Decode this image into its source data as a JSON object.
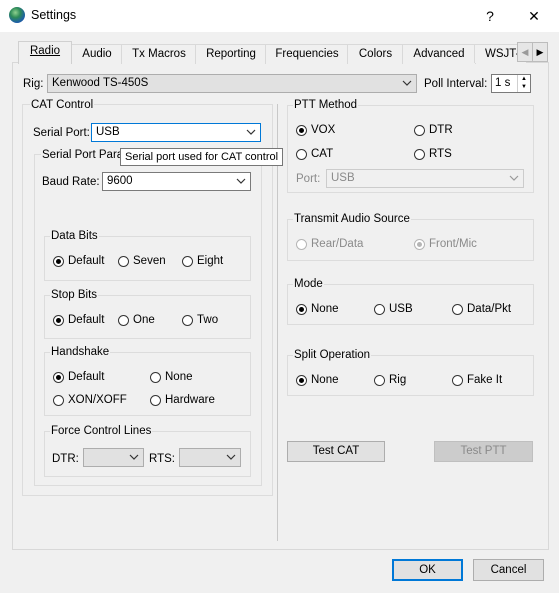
{
  "window": {
    "title": "Settings",
    "help_label": "?",
    "close_label": "✕"
  },
  "tabs": [
    "Radio",
    "Audio",
    "Tx Macros",
    "Reporting",
    "Frequencies",
    "Colors",
    "Advanced",
    "WSJT-Z"
  ],
  "active_tab": "Radio",
  "rig": {
    "label": "Rig:",
    "value": "Kenwood TS-450S",
    "poll_label": "Poll Interval:",
    "poll_value": "1 s"
  },
  "cat_control": {
    "title": "CAT Control",
    "serial_port_label": "Serial Port:",
    "serial_port_value": "USB",
    "serial_params_title": "Serial Port Param",
    "tooltip": "Serial port used for CAT control",
    "baud_rate_label": "Baud Rate:",
    "baud_rate_value": "9600",
    "data_bits": {
      "title": "Data Bits",
      "options": [
        "Default",
        "Seven",
        "Eight"
      ],
      "selected": "Default"
    },
    "stop_bits": {
      "title": "Stop Bits",
      "options": [
        "Default",
        "One",
        "Two"
      ],
      "selected": "Default"
    },
    "handshake": {
      "title": "Handshake",
      "options": [
        "Default",
        "None",
        "XON/XOFF",
        "Hardware"
      ],
      "selected": "Default"
    },
    "force_lines": {
      "title": "Force Control Lines",
      "dtr_label": "DTR:",
      "rts_label": "RTS:"
    }
  },
  "ptt": {
    "title": "PTT Method",
    "options": [
      "VOX",
      "DTR",
      "CAT",
      "RTS"
    ],
    "selected": "VOX",
    "port_label": "Port:",
    "port_value": "USB"
  },
  "tx_audio": {
    "title": "Transmit Audio Source",
    "options": [
      "Rear/Data",
      "Front/Mic"
    ],
    "selected": "Front/Mic"
  },
  "mode": {
    "title": "Mode",
    "options": [
      "None",
      "USB",
      "Data/Pkt"
    ],
    "selected": "None"
  },
  "split": {
    "title": "Split Operation",
    "options": [
      "None",
      "Rig",
      "Fake It"
    ],
    "selected": "None"
  },
  "buttons": {
    "test_cat": "Test CAT",
    "test_ptt": "Test PTT",
    "ok": "OK",
    "cancel": "Cancel"
  },
  "colors": {
    "accent": "#0078d7"
  }
}
